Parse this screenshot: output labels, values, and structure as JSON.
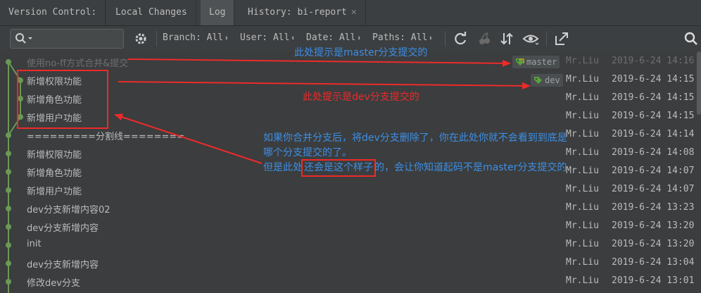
{
  "tabs": {
    "vc_label": "Version Control:",
    "local_changes": "Local Changes",
    "log": "Log",
    "history": "History: bi-report"
  },
  "filters": {
    "branch": "Branch: All",
    "user": "User: All",
    "date": "Date: All",
    "paths": "Paths: All"
  },
  "commits": [
    {
      "message": "使用no-ff方式合并&提交",
      "author": "Mr.Liu",
      "date": "2019-6-24 14:16",
      "tag": "master",
      "dim": true
    },
    {
      "message": "新增权限功能",
      "author": "Mr.Liu",
      "date": "2019-6-24 14:15",
      "tag": "dev"
    },
    {
      "message": "新增角色功能",
      "author": "Mr.Liu",
      "date": "2019-6-24 14:15"
    },
    {
      "message": "新增用户功能",
      "author": "Mr.Liu",
      "date": "2019-6-24 14:15"
    },
    {
      "message": "=========分割线========",
      "author": "Mr.Liu",
      "date": "2019-6-24 14:14"
    },
    {
      "message": "新增权限功能",
      "author": "Mr.Liu",
      "date": "2019-6-24 14:08"
    },
    {
      "message": "新增角色功能",
      "author": "Mr.Liu",
      "date": "2019-6-24 14:07"
    },
    {
      "message": "新增用户功能",
      "author": "Mr.Liu",
      "date": "2019-6-24 14:07"
    },
    {
      "message": "dev分支新增内容02",
      "author": "Mr.Liu",
      "date": "2019-6-24 13:23"
    },
    {
      "message": "dev分支新增内容",
      "author": "Mr.Liu",
      "date": "2019-6-24 13:20"
    },
    {
      "message": "init",
      "author": "Mr.Liu",
      "date": "2019-6-24 13:20"
    },
    {
      "message": "dev分支新增内容",
      "author": "Mr.Liu",
      "date": "2019-6-24 13:04"
    },
    {
      "message": "修改dev分支",
      "author": "Mr.Liu",
      "date": "2019-6-24 13:01"
    }
  ],
  "annotations": {
    "master_note": "此处提示是master分支提交的",
    "dev_note": "此处提示是dev分支提交的",
    "para_line1": "如果你合并分支后，将dev分支删除了，你在此处你就不会看到到底是哪个分支提交的了。",
    "para_line2_pre": "但是此处",
    "para_line2_highlight": "还会是这个样子",
    "para_line2_post": "的，会让你知道起码不是master分支提交的"
  },
  "colors": {
    "graph_green": "#6a9955",
    "tag_green": "#5aa03c",
    "annotation_blue": "#3d8fe6",
    "annotation_red": "#ee2a2a"
  }
}
